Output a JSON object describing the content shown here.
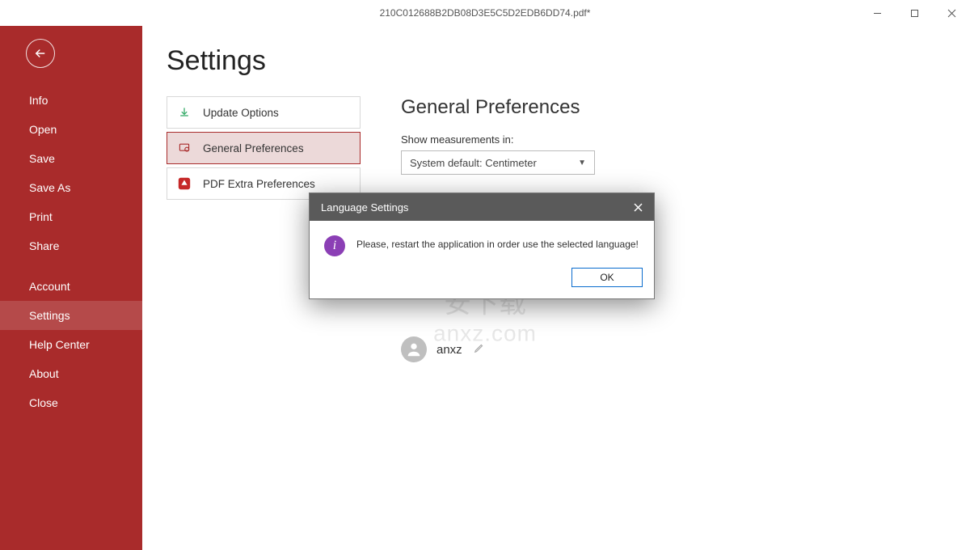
{
  "window": {
    "title": "210C012688B2DB08D3E5C5D2EDB6DD74.pdf*"
  },
  "sidebar": {
    "items": [
      {
        "label": "Info"
      },
      {
        "label": "Open"
      },
      {
        "label": "Save"
      },
      {
        "label": "Save As"
      },
      {
        "label": "Print"
      },
      {
        "label": "Share"
      },
      {
        "label": "Account"
      },
      {
        "label": "Settings"
      },
      {
        "label": "Help Center"
      },
      {
        "label": "About"
      },
      {
        "label": "Close"
      }
    ]
  },
  "page": {
    "title": "Settings"
  },
  "settings_list": {
    "items": [
      {
        "label": "Update Options"
      },
      {
        "label": "General Preferences"
      },
      {
        "label": "PDF Extra Preferences"
      }
    ]
  },
  "prefs": {
    "title": "General Preferences",
    "measure_label": "Show measurements in:",
    "measure_value": "System default: Centimeter",
    "author_name": "anxz"
  },
  "dialog": {
    "title": "Language Settings",
    "message": "Please, restart the application in order use the selected language!",
    "ok": "OK"
  },
  "watermark": {
    "line1": "安下载",
    "line2": "anxz.com"
  }
}
